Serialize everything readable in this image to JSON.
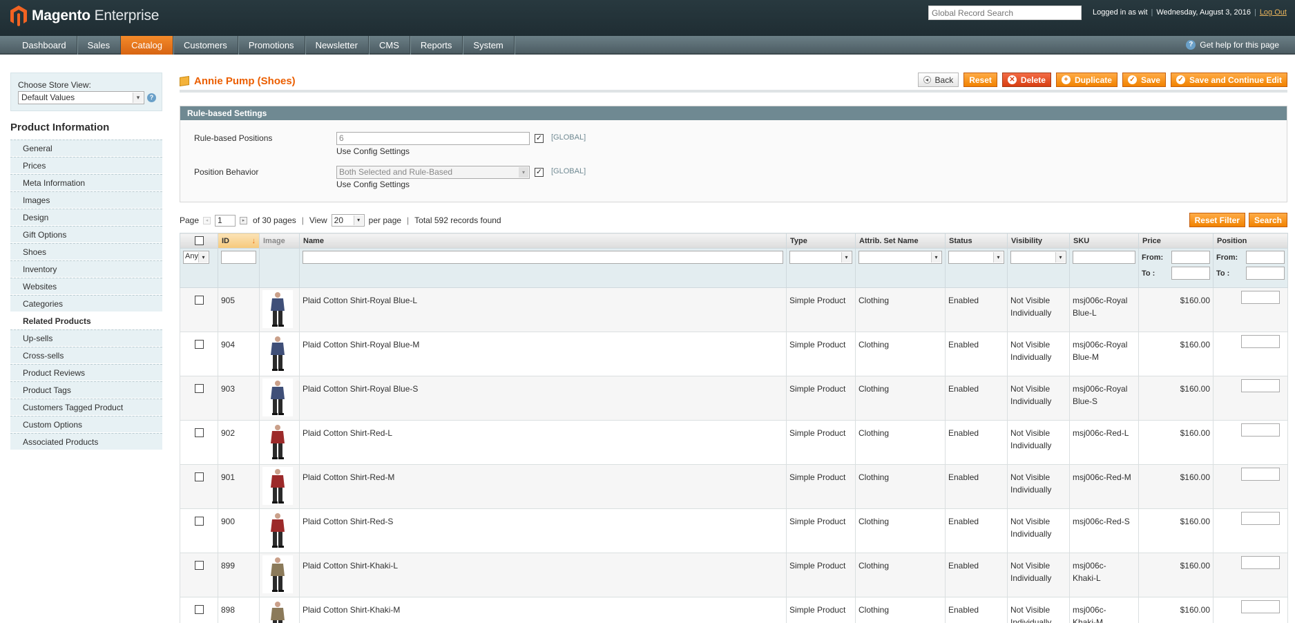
{
  "header": {
    "brand_bold": "Magento",
    "brand_light": "Enterprise",
    "search_placeholder": "Global Record Search",
    "logged_in": "Logged in as wit",
    "date": "Wednesday, August 3, 2016",
    "logout": "Log Out"
  },
  "nav": {
    "items": [
      "Dashboard",
      "Sales",
      "Catalog",
      "Customers",
      "Promotions",
      "Newsletter",
      "CMS",
      "Reports",
      "System"
    ],
    "active": "Catalog",
    "help": "Get help for this page"
  },
  "store": {
    "label": "Choose Store View:",
    "value": "Default Values"
  },
  "sidebar": {
    "title": "Product Information",
    "items": [
      "General",
      "Prices",
      "Meta Information",
      "Images",
      "Design",
      "Gift Options",
      "Shoes",
      "Inventory",
      "Websites",
      "Categories",
      "Related Products",
      "Up-sells",
      "Cross-sells",
      "Product Reviews",
      "Product Tags",
      "Customers Tagged Product",
      "Custom Options",
      "Associated Products"
    ],
    "active": "Related Products"
  },
  "page": {
    "title": "Annie Pump (Shoes)",
    "buttons": {
      "back": "Back",
      "reset": "Reset",
      "delete": "Delete",
      "duplicate": "Duplicate",
      "save": "Save",
      "save_continue": "Save and Continue Edit"
    }
  },
  "rules": {
    "header": "Rule-based Settings",
    "positions_label": "Rule-based Positions",
    "positions_value": "6",
    "behavior_label": "Position Behavior",
    "behavior_value": "Both Selected and Rule-Based",
    "use_config": "Use Config Settings",
    "scope": "[GLOBAL]"
  },
  "pager": {
    "page_label": "Page",
    "page": "1",
    "of_pages": "of 30 pages",
    "view_label": "View",
    "per_page": "20",
    "per_page_label": "per page",
    "total": "Total 592 records found",
    "reset_filter": "Reset Filter",
    "search": "Search"
  },
  "grid": {
    "columns": [
      "",
      "ID",
      "Image",
      "Name",
      "Type",
      "Attrib. Set Name",
      "Status",
      "Visibility",
      "SKU",
      "Price",
      "Position"
    ],
    "filter_any": "Any",
    "from": "From:",
    "to": "To :",
    "rows": [
      {
        "id": "905",
        "name": "Plaid Cotton Shirt-Royal Blue-L",
        "type": "Simple Product",
        "set": "Clothing",
        "status": "Enabled",
        "vis1": "Not Visible",
        "vis2": "Individually",
        "sku1": "msj006c-Royal",
        "sku2": "Blue-L",
        "price": "$160.00",
        "shirt": "#3f4f78"
      },
      {
        "id": "904",
        "name": "Plaid Cotton Shirt-Royal Blue-M",
        "type": "Simple Product",
        "set": "Clothing",
        "status": "Enabled",
        "vis1": "Not Visible",
        "vis2": "Individually",
        "sku1": "msj006c-Royal",
        "sku2": "Blue-M",
        "price": "$160.00",
        "shirt": "#3f4f78"
      },
      {
        "id": "903",
        "name": "Plaid Cotton Shirt-Royal Blue-S",
        "type": "Simple Product",
        "set": "Clothing",
        "status": "Enabled",
        "vis1": "Not Visible",
        "vis2": "Individually",
        "sku1": "msj006c-Royal",
        "sku2": "Blue-S",
        "price": "$160.00",
        "shirt": "#3f4f78"
      },
      {
        "id": "902",
        "name": "Plaid Cotton Shirt-Red-L",
        "type": "Simple Product",
        "set": "Clothing",
        "status": "Enabled",
        "vis1": "Not Visible",
        "vis2": "Individually",
        "sku1": "msj006c-Red-L",
        "sku2": "",
        "price": "$160.00",
        "shirt": "#9c2a2a"
      },
      {
        "id": "901",
        "name": "Plaid Cotton Shirt-Red-M",
        "type": "Simple Product",
        "set": "Clothing",
        "status": "Enabled",
        "vis1": "Not Visible",
        "vis2": "Individually",
        "sku1": "msj006c-Red-M",
        "sku2": "",
        "price": "$160.00",
        "shirt": "#9c2a2a"
      },
      {
        "id": "900",
        "name": "Plaid Cotton Shirt-Red-S",
        "type": "Simple Product",
        "set": "Clothing",
        "status": "Enabled",
        "vis1": "Not Visible",
        "vis2": "Individually",
        "sku1": "msj006c-Red-S",
        "sku2": "",
        "price": "$160.00",
        "shirt": "#9c2a2a"
      },
      {
        "id": "899",
        "name": "Plaid Cotton Shirt-Khaki-L",
        "type": "Simple Product",
        "set": "Clothing",
        "status": "Enabled",
        "vis1": "Not Visible",
        "vis2": "Individually",
        "sku1": "msj006c-",
        "sku2": "Khaki-L",
        "price": "$160.00",
        "shirt": "#8b7a5a"
      },
      {
        "id": "898",
        "name": "Plaid Cotton Shirt-Khaki-M",
        "type": "Simple Product",
        "set": "Clothing",
        "status": "Enabled",
        "vis1": "Not Visible",
        "vis2": "Individually",
        "sku1": "msj006c-",
        "sku2": "Khaki-M",
        "price": "$160.00",
        "shirt": "#8b7a5a"
      }
    ]
  },
  "colors": {
    "accent": "#eb5e00",
    "header_bg": "#28393f",
    "fieldset_head": "#6f8992"
  }
}
